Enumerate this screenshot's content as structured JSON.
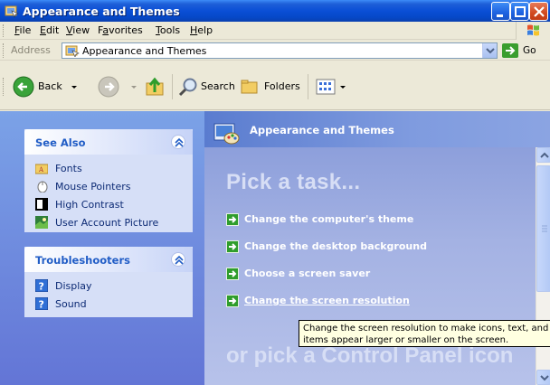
{
  "window": {
    "title": "Appearance and Themes"
  },
  "menubar": {
    "items": [
      {
        "label": "File",
        "mnemonic": "F",
        "rest": "ile"
      },
      {
        "label": "Edit",
        "mnemonic": "E",
        "rest": "dit"
      },
      {
        "label": "View",
        "mnemonic": "V",
        "rest": "iew"
      },
      {
        "label": "Favorites",
        "mnemonic": "a",
        "pre": "F",
        "rest": "vorites"
      },
      {
        "label": "Tools",
        "mnemonic": "T",
        "rest": "ools"
      },
      {
        "label": "Help",
        "mnemonic": "H",
        "rest": "elp"
      }
    ]
  },
  "addressbar": {
    "label": "Address",
    "value": "Appearance and Themes",
    "go_label": "Go"
  },
  "toolbar": {
    "back_label": "Back",
    "search_label": "Search",
    "folders_label": "Folders"
  },
  "see_also": {
    "title": "See Also",
    "items": [
      {
        "label": "Fonts",
        "icon": "folder-fonts-icon"
      },
      {
        "label": "Mouse Pointers",
        "icon": "mouse-pointer-icon"
      },
      {
        "label": "High Contrast",
        "icon": "high-contrast-icon"
      },
      {
        "label": "User Account Picture",
        "icon": "user-picture-icon"
      }
    ]
  },
  "troubleshooters": {
    "title": "Troubleshooters",
    "items": [
      {
        "label": "Display",
        "icon": "help-icon"
      },
      {
        "label": "Sound",
        "icon": "help-icon"
      }
    ]
  },
  "main": {
    "header_title": "Appearance and Themes",
    "pick_heading": "Pick a task...",
    "tasks": [
      "Change the computer's theme",
      "Change the desktop background",
      "Choose a screen saver",
      "Change the screen resolution"
    ],
    "or_pick_heading": "or pick a Control Panel icon"
  },
  "tooltip": {
    "line1": "Change the screen resolution to make icons, text, and ot",
    "line2": "items appear larger or smaller on the screen."
  },
  "colors": {
    "titlebar": "#0a4fd6",
    "left_pane": "#6f8fe0",
    "task_arrow": "#2f9d2c",
    "link_blue": "#215dc6"
  }
}
